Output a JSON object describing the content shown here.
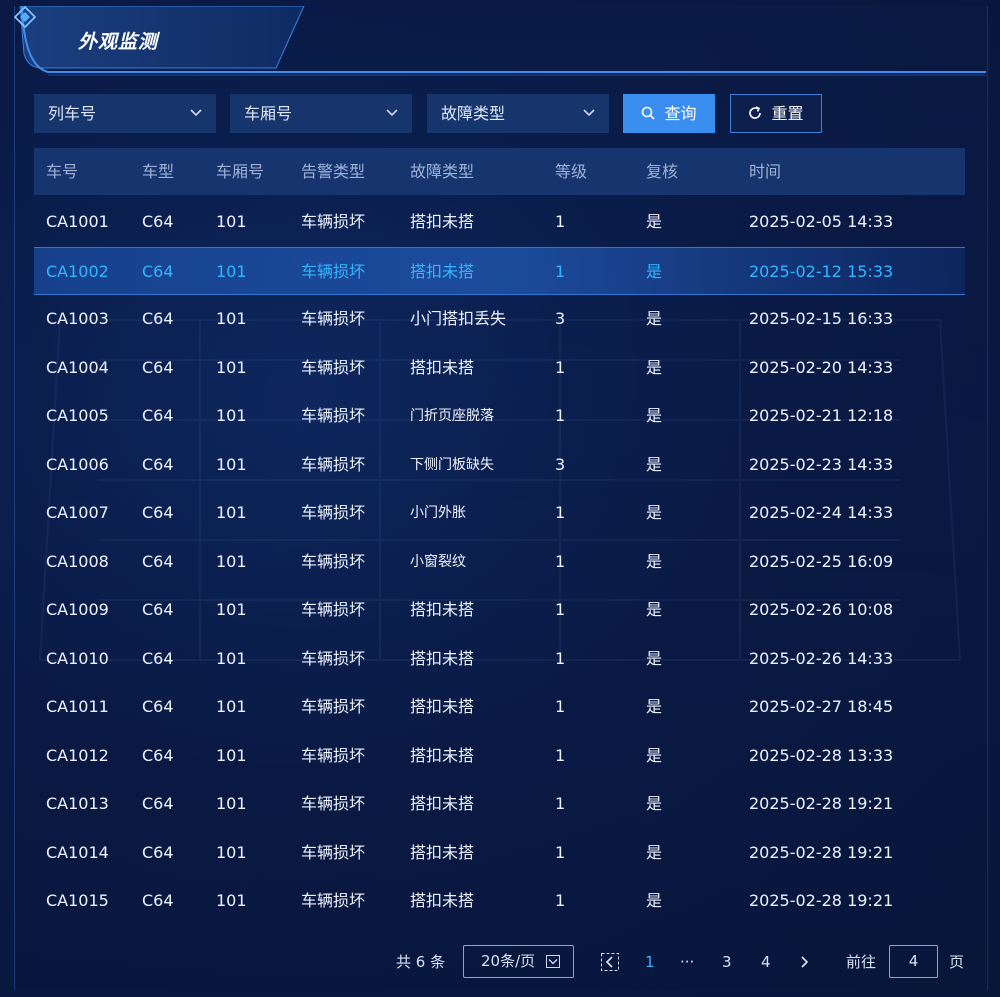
{
  "title": "外观监测",
  "filters": {
    "train_no": "列车号",
    "car_no": "车厢号",
    "fault_type": "故障类型",
    "query_label": "查询",
    "reset_label": "重置"
  },
  "columns": [
    "车号",
    "车型",
    "车厢号",
    "告警类型",
    "故障类型",
    "等级",
    "复核",
    "时间"
  ],
  "rows": [
    [
      "CA1001",
      "C64",
      "101",
      "车辆损坏",
      "搭扣未搭",
      "1",
      "是",
      "2025-02-05 14:33"
    ],
    [
      "CA1002",
      "C64",
      "101",
      "车辆损坏",
      "搭扣未搭",
      "1",
      "是",
      "2025-02-12 15:33"
    ],
    [
      "CA1003",
      "C64",
      "101",
      "车辆损坏",
      "小门搭扣丢失",
      "3",
      "是",
      "2025-02-15 16:33"
    ],
    [
      "CA1004",
      "C64",
      "101",
      "车辆损坏",
      "搭扣未搭",
      "1",
      "是",
      "2025-02-20 14:33"
    ],
    [
      "CA1005",
      "C64",
      "101",
      "车辆损坏",
      "门折页座脱落",
      "1",
      "是",
      "2025-02-21 12:18"
    ],
    [
      "CA1006",
      "C64",
      "101",
      "车辆损坏",
      "下侧门板缺失",
      "3",
      "是",
      "2025-02-23 14:33"
    ],
    [
      "CA1007",
      "C64",
      "101",
      "车辆损坏",
      "小门外胀",
      "1",
      "是",
      "2025-02-24 14:33"
    ],
    [
      "CA1008",
      "C64",
      "101",
      "车辆损坏",
      "小窗裂纹",
      "1",
      "是",
      "2025-02-25 16:09"
    ],
    [
      "CA1009",
      "C64",
      "101",
      "车辆损坏",
      "搭扣未搭",
      "1",
      "是",
      "2025-02-26 10:08"
    ],
    [
      "CA1010",
      "C64",
      "101",
      "车辆损坏",
      "搭扣未搭",
      "1",
      "是",
      "2025-02-26 14:33"
    ],
    [
      "CA1011",
      "C64",
      "101",
      "车辆损坏",
      "搭扣未搭",
      "1",
      "是",
      "2025-02-27 18:45"
    ],
    [
      "CA1012",
      "C64",
      "101",
      "车辆损坏",
      "搭扣未搭",
      "1",
      "是",
      "2025-02-28 13:33"
    ],
    [
      "CA1013",
      "C64",
      "101",
      "车辆损坏",
      "搭扣未搭",
      "1",
      "是",
      "2025-02-28 19:21"
    ],
    [
      "CA1014",
      "C64",
      "101",
      "车辆损坏",
      "搭扣未搭",
      "1",
      "是",
      "2025-02-28 19:21"
    ],
    [
      "CA1015",
      "C64",
      "101",
      "车辆损坏",
      "搭扣未搭",
      "1",
      "是",
      "2025-02-28 19:21"
    ]
  ],
  "pagination": {
    "total": "共 6 条",
    "page_size": "20条/页",
    "pages": [
      "1",
      "···",
      "3",
      "4"
    ],
    "current": "1",
    "goto_label": "前往",
    "goto_value": "4",
    "page_suffix": "页"
  },
  "colors": {
    "accent": "#3a8ef0",
    "selected_text": "#35b5ff",
    "header_bg": "#16346e"
  }
}
